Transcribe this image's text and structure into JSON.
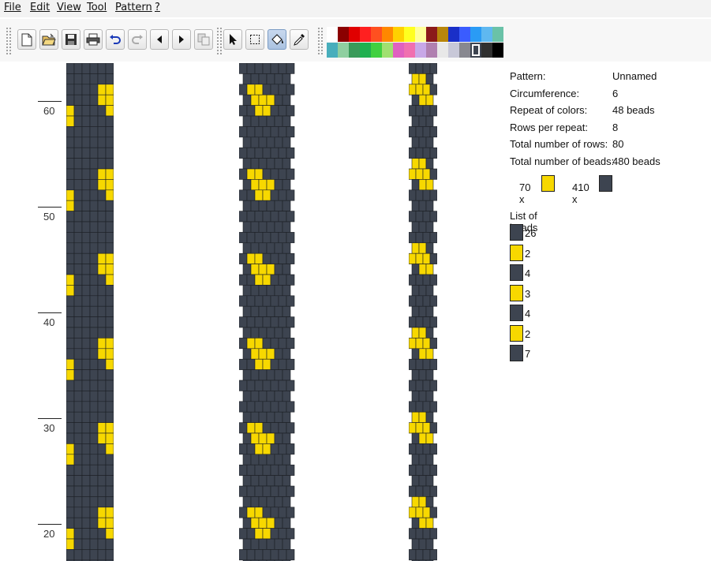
{
  "menu": [
    "File",
    "Edit",
    "View",
    "Tool",
    "Pattern",
    "?"
  ],
  "toolbar": {
    "buttons": [
      "new-file-icon",
      "open-folder-icon",
      "save-disk-icon",
      "print-icon",
      "undo-icon",
      "redo-icon",
      "arrow-left-icon",
      "arrow-right-icon",
      "copy-icon",
      "pointer-icon",
      "select-rect-icon",
      "fill-bucket-icon",
      "color-picker-icon"
    ],
    "active_tool": "fill-bucket-icon"
  },
  "palette": {
    "row1": [
      "#ffffff",
      "#8b0000",
      "#e00000",
      "#ff2020",
      "#ff5020",
      "#ff8800",
      "#ffd000",
      "#ffff20",
      "#ffff99",
      "#8b1a1a",
      "#b8860b",
      "#1a2fc8",
      "#3a5cff",
      "#2a9bf5",
      "#5fb8f0",
      "#6ac2a8"
    ],
    "row2": [
      "#48aebc",
      "#8fcfa0",
      "#3a9a5a",
      "#20b050",
      "#40d040",
      "#a0e070",
      "#e060c0",
      "#f070b0",
      "#c8a8e8",
      "#b080b0",
      "#e8e8e8",
      "#c8c8d8",
      "#888890",
      "#3d4450",
      "#303030",
      "#000000"
    ],
    "selected": "#3d4450"
  },
  "ruler": {
    "labels": [
      "60",
      "50",
      "40",
      "30",
      "20"
    ]
  },
  "pattern_colors": {
    "dark": "#3d4450",
    "bead": "#f7d800"
  },
  "info": {
    "pattern_label": "Pattern:",
    "pattern_value": "Unnamed",
    "circumference_label": "Circumference:",
    "circumference_value": "6",
    "repeat_label": "Repeat of colors:",
    "repeat_value": "48 beads",
    "rows_repeat_label": "Rows per repeat:",
    "rows_repeat_value": "8",
    "total_rows_label": "Total number of rows:",
    "total_rows_value": "80",
    "total_beads_label": "Total number of beads:",
    "total_beads_value": "480 beads",
    "count_yellow": "70 x",
    "count_dark": "410 x",
    "list_title": "List of beads",
    "list": [
      {
        "color": "#3d4450",
        "count": "26"
      },
      {
        "color": "#f7d800",
        "count": "2"
      },
      {
        "color": "#3d4450",
        "count": "4"
      },
      {
        "color": "#f7d800",
        "count": "3"
      },
      {
        "color": "#3d4450",
        "count": "4"
      },
      {
        "color": "#f7d800",
        "count": "2"
      },
      {
        "color": "#3d4450",
        "count": "7"
      }
    ]
  }
}
